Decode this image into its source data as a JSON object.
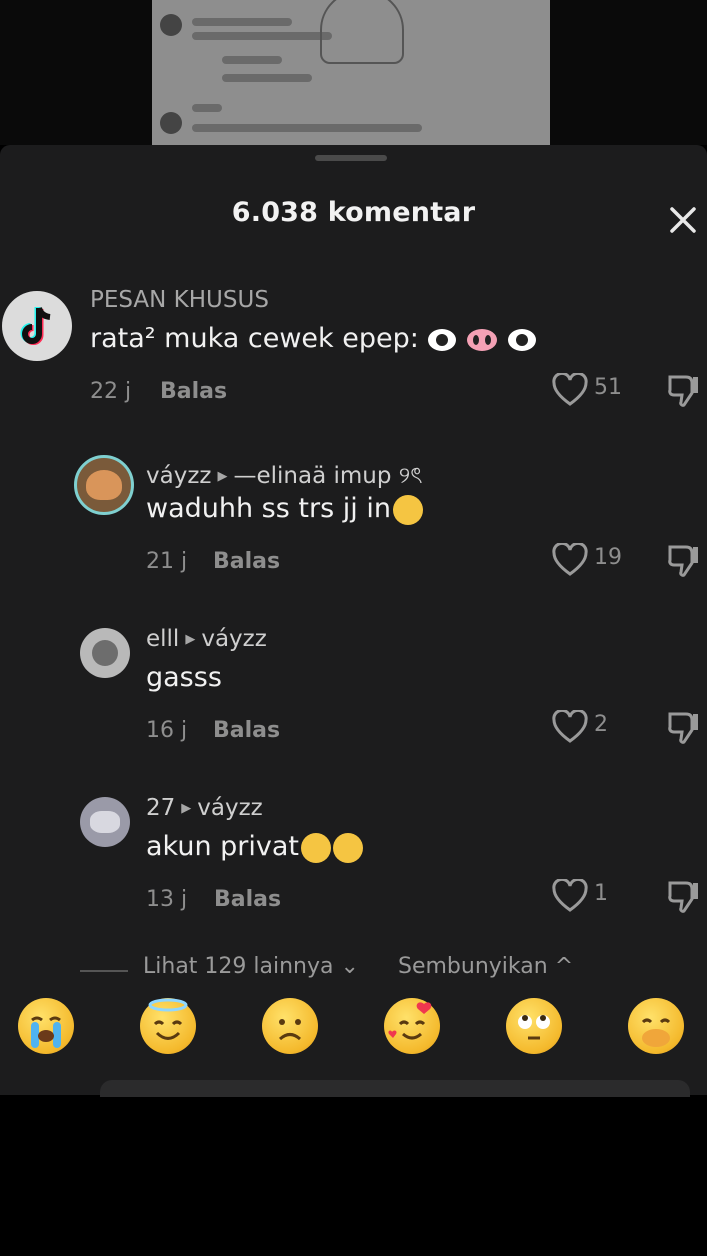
{
  "header": {
    "comment_count_title": "6.038 komentar",
    "close_icon": "close-icon"
  },
  "comments": [
    {
      "username": "PESAN KHUSUS",
      "text": "rata² muka cewek epep:",
      "emojis": [
        "eyes-emoji",
        "pig-nose-emoji",
        "eyes-emoji"
      ],
      "time": "22 j",
      "reply_label": "Balas",
      "likes": "51",
      "avatar": "tiktok-logo-avatar"
    },
    {
      "username": "váyzz",
      "reply_to": "—elinaä imup ୨ৎ",
      "text": "waduhh ss trs jj in",
      "emojis": [
        "shushing-emoji"
      ],
      "time": "21 j",
      "reply_label": "Balas",
      "likes": "19",
      "avatar": "user-avatar"
    },
    {
      "username": "elll",
      "reply_to": "váyzz",
      "text": "gasss",
      "time": "16 j",
      "reply_label": "Balas",
      "likes": "2",
      "avatar": "user-avatar"
    },
    {
      "username": "27",
      "reply_to": "váyzz",
      "text": "akun privat",
      "emojis": [
        "cat-smile-emoji",
        "cat-smile-emoji"
      ],
      "time": "13 j",
      "reply_label": "Balas",
      "likes": "1",
      "avatar": "user-avatar"
    }
  ],
  "thread_controls": {
    "view_more": "Lihat 129 lainnya",
    "hide": "Sembunyikan"
  },
  "emoji_bar": [
    "loudly-crying-emoji",
    "halo-emoji",
    "frowning-emoji",
    "smiling-hearts-emoji",
    "rolling-eyes-emoji",
    "hand-over-mouth-emoji"
  ],
  "colors": {
    "sheet_bg": "#1c1c1d",
    "username": "#a7a7a7",
    "meta": "#8e8e8e",
    "text": "#f1f1f1"
  }
}
